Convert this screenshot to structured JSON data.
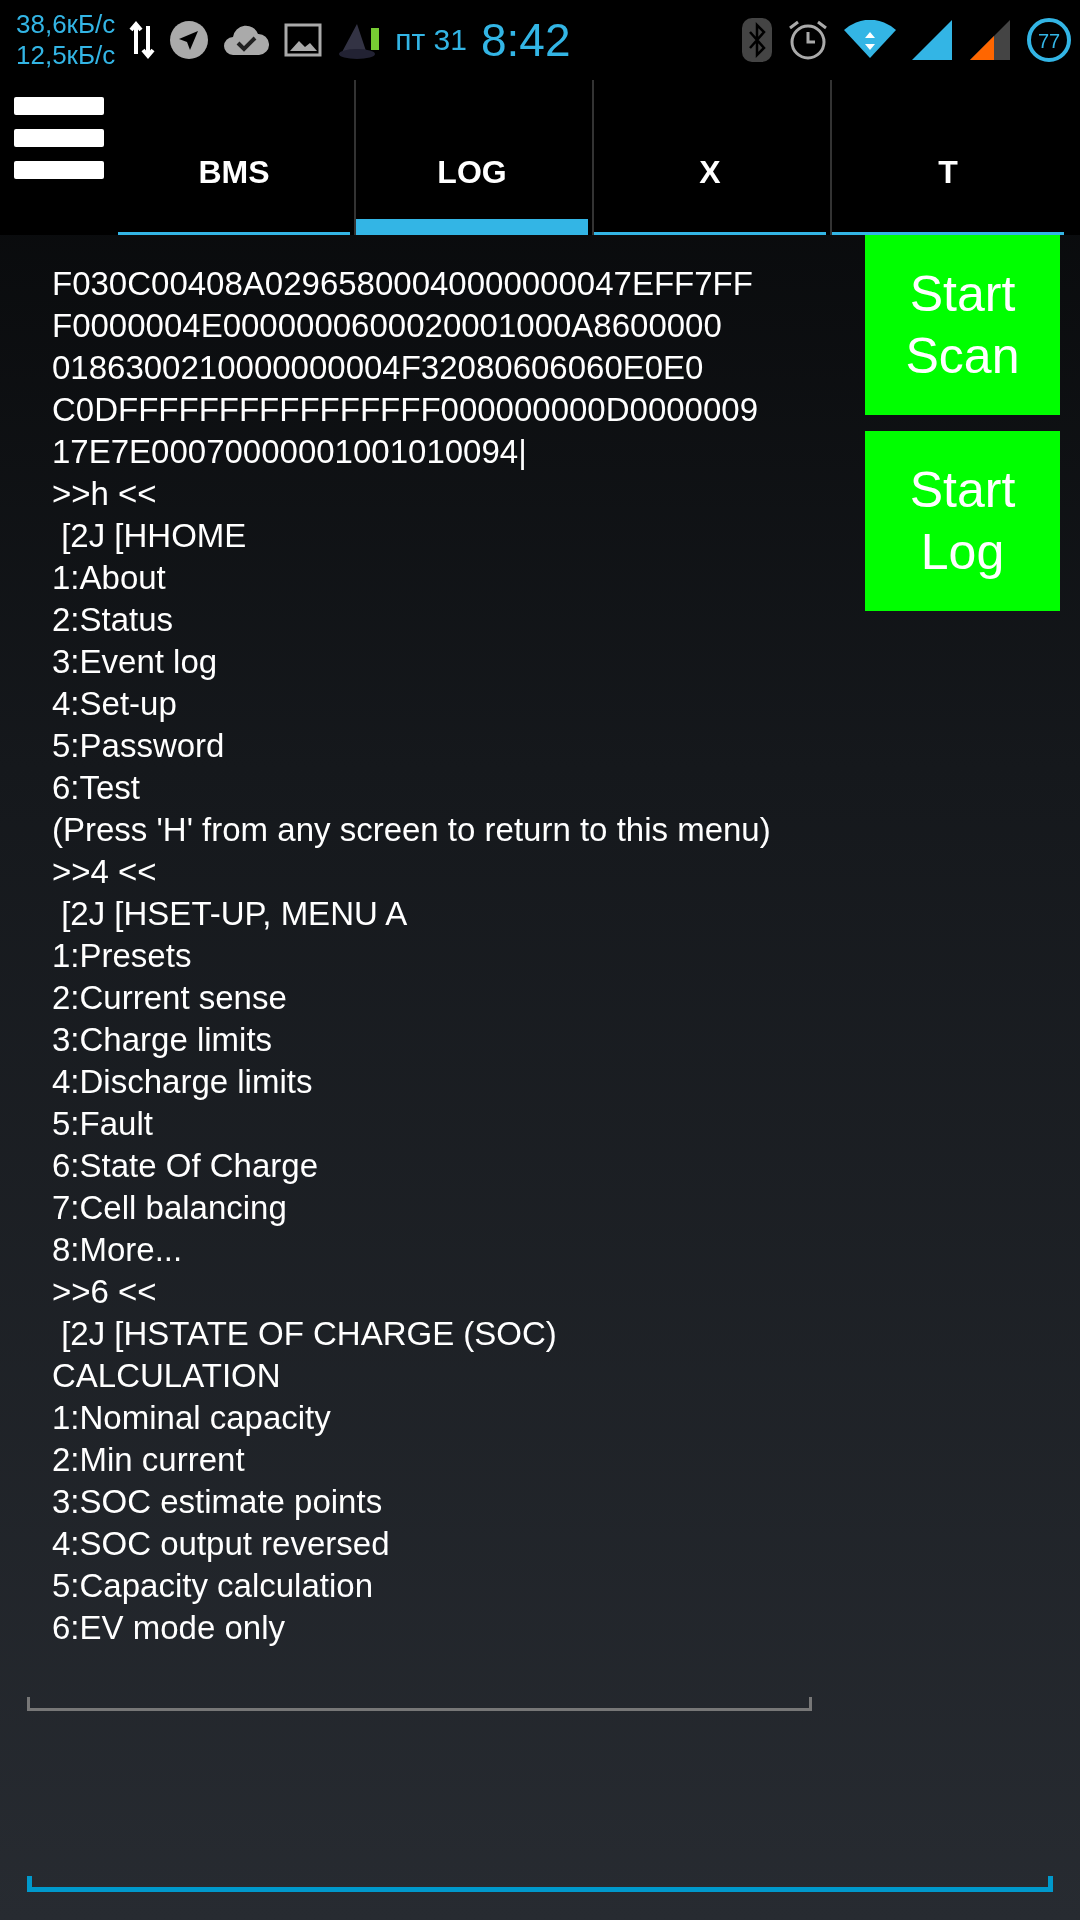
{
  "status_bar": {
    "upload_speed": "38,6кБ/с",
    "download_speed": "12,5кБ/с",
    "date": "пт 31",
    "time": "8:42",
    "battery": "77"
  },
  "tabs": [
    {
      "label": "BMS",
      "selected": false
    },
    {
      "label": "LOG",
      "selected": true
    },
    {
      "label": "X",
      "selected": false
    },
    {
      "label": "T",
      "selected": false
    }
  ],
  "log_lines": [
    "F030C00408A02965800040000000047EFF7FF",
    "F0000004E0000000600020001000A8600000",
    "0186300210000000004F32080606060E0E0",
    "C0DFFFFFFFFFFFFFFFF000000000D0000009",
    "17E7E00070000001001010094|",
    ">>h <<",
    " [2J [HHOME",
    "1:About",
    "2:Status",
    "3:Event log",
    "4:Set-up",
    "5:Password",
    "6:Test",
    "(Press 'H' from any screen to return to this menu)",
    ">>4 <<",
    " [2J [HSET-UP, MENU A",
    "1:Presets",
    "2:Current sense",
    "3:Charge limits",
    "4:Discharge limits",
    "5:Fault",
    "6:State Of Charge",
    "7:Cell balancing",
    "8:More...",
    ">>6 <<",
    " [2J [HSTATE OF CHARGE (SOC) CALCULATION",
    "1:Nominal capacity",
    "2:Min current",
    "3:SOC estimate points",
    "4:SOC output reversed",
    "5:Capacity calculation",
    "6:EV mode only"
  ],
  "buttons": [
    {
      "label": "Start Scan"
    },
    {
      "label": "Start Log"
    }
  ]
}
